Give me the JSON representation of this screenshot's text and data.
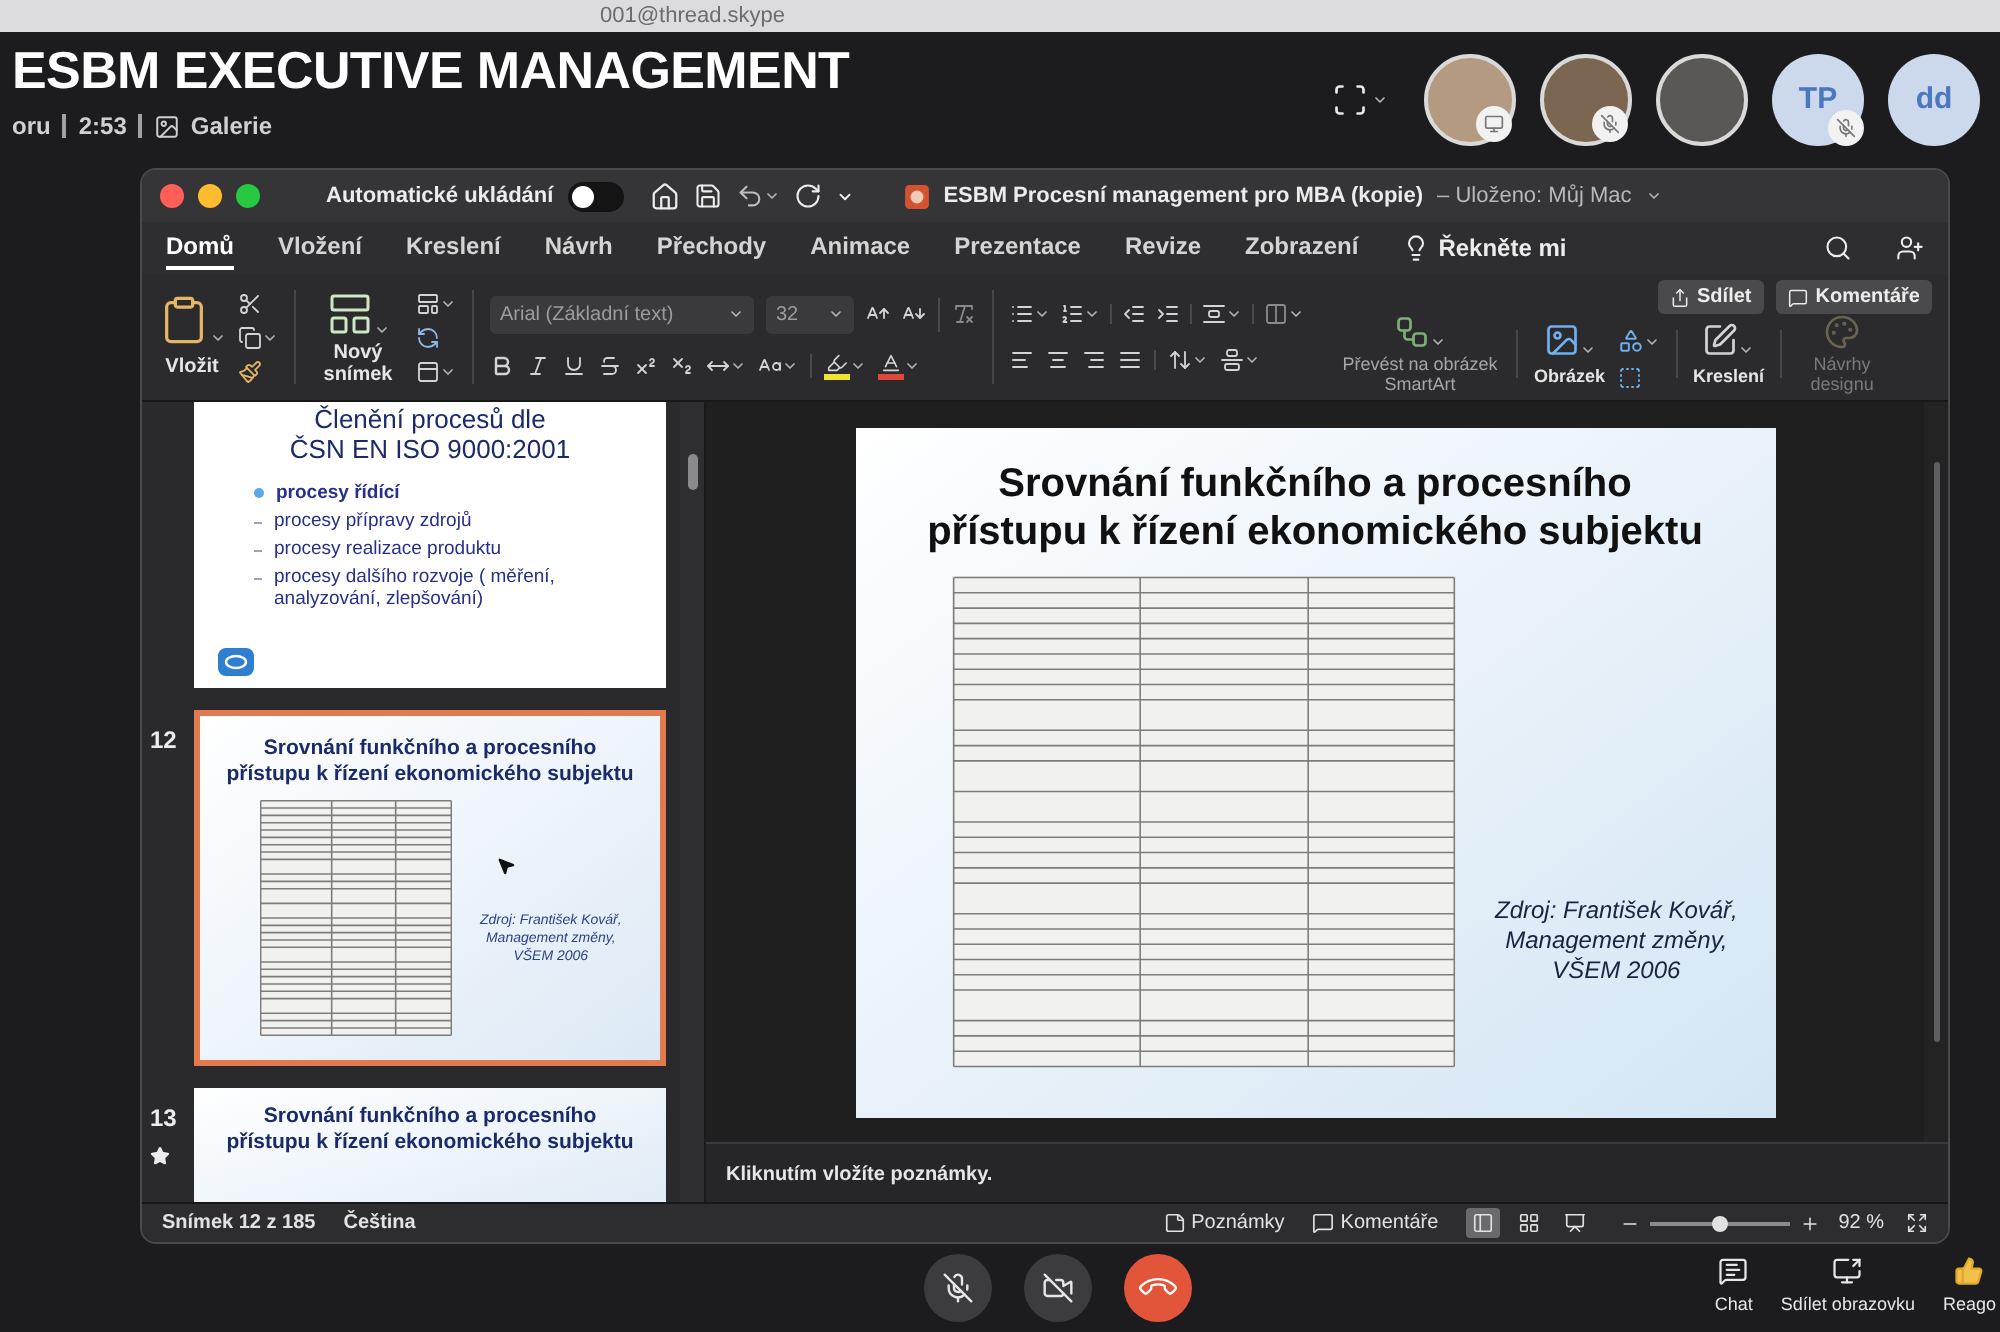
{
  "browser_bar": {
    "address": "001@thread.skype"
  },
  "meeting": {
    "title": "ESBM EXECUTIVE MANAGEMENT",
    "status": "oru",
    "duration": "2:53",
    "view": "Galerie"
  },
  "participants": [
    {
      "kind": "photo",
      "presenting": true,
      "muted": false
    },
    {
      "kind": "photo",
      "presenting": false,
      "muted": true
    },
    {
      "kind": "photo",
      "presenting": false,
      "muted": false
    },
    {
      "kind": "initials",
      "initials": "TP",
      "presenting": false,
      "muted": true
    },
    {
      "kind": "initials",
      "initials": "dd",
      "presenting": false,
      "muted": false
    }
  ],
  "powerpoint": {
    "autosave": {
      "label": "Automatické ukládání",
      "on": false
    },
    "document_title": "ESBM Procesní management pro MBA (kopie)",
    "save_status": "– Uloženo: Můj Mac",
    "tabs": [
      {
        "label": "Domů",
        "selected": true
      },
      {
        "label": "Vložení",
        "selected": false
      },
      {
        "label": "Kreslení",
        "selected": false
      },
      {
        "label": "Návrh",
        "selected": false
      },
      {
        "label": "Přechody",
        "selected": false
      },
      {
        "label": "Animace",
        "selected": false
      },
      {
        "label": "Prezentace",
        "selected": false
      },
      {
        "label": "Revize",
        "selected": false
      },
      {
        "label": "Zobrazení",
        "selected": false
      }
    ],
    "tell_me": "Řekněte mi",
    "share_button": "Sdílet",
    "comments_button": "Komentáře",
    "ribbon": {
      "paste": "Vložit",
      "new_slide": "Nový snímek",
      "font": "Arial (Základní text)",
      "font_size": "32",
      "smartart": "Převést na obrázek SmartArt",
      "picture": "Obrázek",
      "drawing": "Kreslení",
      "designer": {
        "label": "Návrhy designu",
        "disabled": true
      }
    },
    "slides": [
      {
        "kind": "bullets",
        "selected": false,
        "title": [
          "Členění procesů dle",
          "ČSN EN ISO 9000:2001"
        ],
        "bullets": [
          {
            "kind": "main",
            "text": "procesy řídící"
          },
          {
            "kind": "sub",
            "text": "procesy přípravy zdrojů"
          },
          {
            "kind": "sub",
            "text": "procesy realizace produktu"
          },
          {
            "kind": "sub",
            "text": "procesy dalšího rozvoje ( měření, analyzování, zlepšování)"
          }
        ]
      },
      {
        "kind": "table",
        "number": "12",
        "selected": true,
        "title": [
          "Srovnání funkčního a procesního",
          "přístupu k řízení ekonomického subjektu"
        ],
        "source": [
          "Zdroj: František Kovář,",
          "Management změny,",
          "VŠEM 2006"
        ]
      },
      {
        "kind": "title",
        "number": "13",
        "selected": false,
        "animated": true,
        "title": [
          "Srovnání funkčního a procesního",
          "přístupu k řízení ekonomického subjektu"
        ]
      }
    ],
    "editor_slide": {
      "title": [
        "Srovnání funkčního a procesního",
        "přístupu k řízení ekonomického subjektu"
      ],
      "source": [
        "Zdroj: František Kovář,",
        "Management změny,",
        "VŠEM 2006"
      ]
    },
    "notes": {
      "placeholder": "Kliknutím vložíte poznámky."
    },
    "status_bar": {
      "position": "Snímek 12 z 185",
      "language": "Čeština",
      "notes": "Poznámky",
      "comments": "Komentáře",
      "views": [
        {
          "kind": "normal",
          "selected": true
        },
        {
          "kind": "sorter",
          "selected": false
        },
        {
          "kind": "reading",
          "selected": false
        }
      ],
      "zoom": {
        "level": 0.5,
        "reading": "92 %"
      }
    }
  },
  "call_controls": {
    "mic_muted": true,
    "camera_off": true
  },
  "call_actions": [
    {
      "kind": "chat",
      "label": "Chat"
    },
    {
      "kind": "share",
      "label": "Sdílet obrazovku"
    },
    {
      "kind": "react",
      "label": "Reago"
    }
  ]
}
